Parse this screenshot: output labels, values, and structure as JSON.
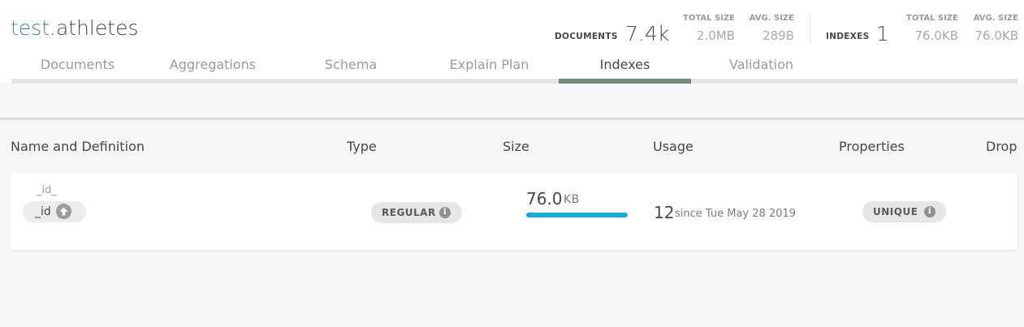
{
  "collection": {
    "db": "test",
    "separator": ".",
    "name": "athletes"
  },
  "stats": {
    "documents_label": "DOCUMENTS",
    "documents_value": "7.4k",
    "doc_total_size_label": "TOTAL SIZE",
    "doc_total_size_value": "2.0MB",
    "doc_avg_size_label": "AVG. SIZE",
    "doc_avg_size_value": "289B",
    "indexes_label": "INDEXES",
    "indexes_value": "1",
    "idx_total_size_label": "TOTAL SIZE",
    "idx_total_size_value": "76.0KB",
    "idx_avg_size_label": "AVG. SIZE",
    "idx_avg_size_value": "76.0KB"
  },
  "tabs": [
    {
      "label": "Documents"
    },
    {
      "label": "Aggregations"
    },
    {
      "label": "Schema"
    },
    {
      "label": "Explain Plan"
    },
    {
      "label": "Indexes",
      "active": true
    },
    {
      "label": "Validation"
    }
  ],
  "columns": {
    "name": "Name and Definition",
    "type": "Type",
    "size": "Size",
    "usage": "Usage",
    "properties": "Properties",
    "drop": "Drop"
  },
  "indexes": [
    {
      "name": "_id_",
      "field": "_id",
      "field_direction_icon": "arrow-up-icon",
      "type": "REGULAR",
      "size_value": "76.0",
      "size_unit": "KB",
      "size_fraction": 1.0,
      "usage_count": "12",
      "usage_since": "since Tue May 28 2019",
      "property": "UNIQUE"
    }
  ],
  "colors": {
    "accent_db": "#3c8a8a",
    "active_tab_bar": "#6f8a7a",
    "size_bar": "#13aee0"
  }
}
